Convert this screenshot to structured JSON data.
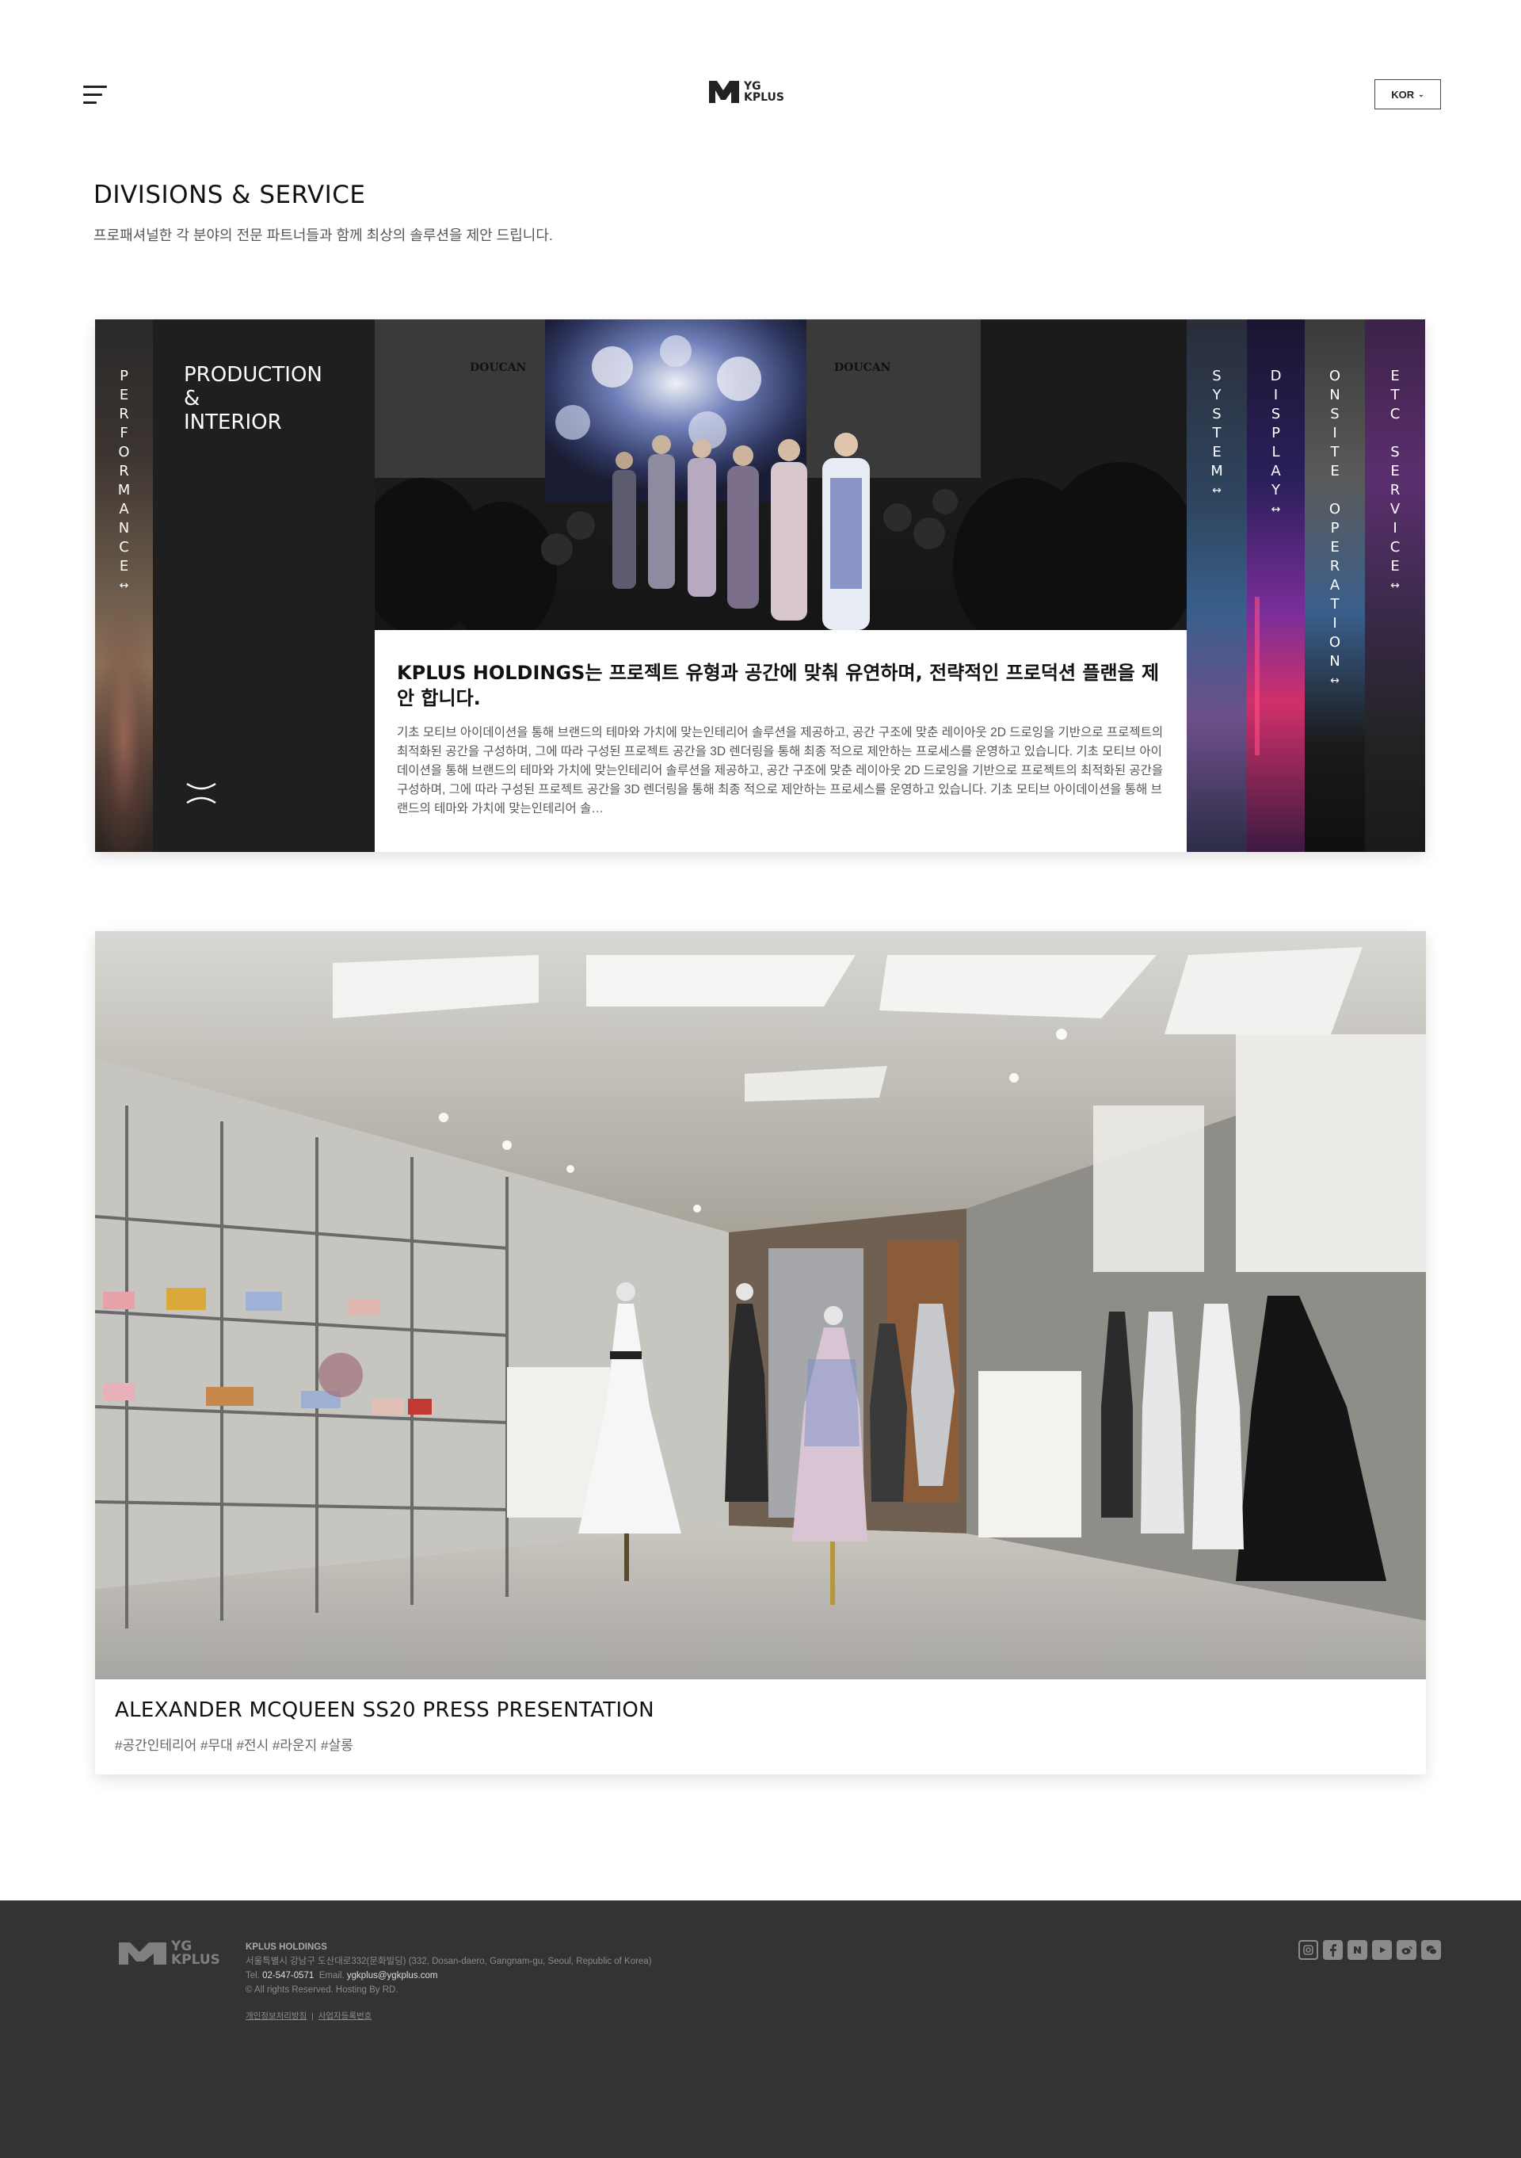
{
  "header": {
    "menu_icon": "hamburger-menu-icon",
    "logo_text": "YG\nKPLUS",
    "language": "KOR",
    "language_chevron": "⌄"
  },
  "section": {
    "title": "DIVISIONS & SERVICE",
    "subtitle": "프로패셔널한 각 분야의 전문 파트너들과 함께 최상의 솔루션을 제안 드립니다."
  },
  "divisions": {
    "arrow": "↔",
    "left_tabs": [
      {
        "label": [
          "P",
          "E",
          "R",
          "F",
          "O",
          "R",
          "M",
          "A",
          "N",
          "C",
          "E"
        ]
      }
    ],
    "active": {
      "title": "PRODUCTION\n&\nINTERIOR",
      "heading": "KPLUS HOLDINGS는 프로젝트 유형과 공간에 맞춰 유연하며, 전략적인 프로덕션 플랜을 제안 합니다.",
      "body": "기초 모티브 아이데이션을 통해 브랜드의 테마와 가치에 맞는인테리어 솔루션을 제공하고, 공간 구조에 맞춘 레이아웃 2D 드로잉을 기반으로 프로젝트의 최적화된 공간을 구성하며, 그에 따라 구성된 프로젝트 공간을 3D 렌더링을 통해 최종 적으로 제안하는 프로세스를 운영하고 있습니다. 기초 모티브 아이데이션을 통해 브랜드의 테마와 가치에 맞는인테리어 솔루션을 제공하고, 공간 구조에 맞춘 레이아웃 2D 드로잉을 기반으로 프로젝트의 최적화된 공간을 구성하며, 그에 따라 구성된 프로젝트 공간을 3D 렌더링을 통해 최종 적으로 제안하는 프로세스를 운영하고 있습니다. 기초 모티브 아이데이션을 통해 브랜드의 테마와 가치에 맞는인테리어 솔…",
      "brand_signage": "DOUCAN"
    },
    "right_tabs": [
      {
        "label": [
          "S",
          "Y",
          "S",
          "T",
          "E",
          "M"
        ]
      },
      {
        "label": [
          "D",
          "I",
          "S",
          "P",
          "L",
          "A",
          "Y"
        ]
      },
      {
        "label": [
          "O",
          "N",
          "S",
          "I",
          "T",
          "E",
          " ",
          "O",
          "P",
          "E",
          "R",
          "A",
          "T",
          "I",
          "O",
          "N"
        ]
      },
      {
        "label": [
          "E",
          "T",
          "C",
          " ",
          "S",
          "E",
          "R",
          "V",
          "I",
          "C",
          "E"
        ]
      }
    ]
  },
  "card": {
    "title": "ALEXANDER MCQUEEN SS20 PRESS PRESENTATION",
    "tags": "#공간인테리어 #무대 #전시 #라운지 #살롱"
  },
  "footer": {
    "logo_text": "YG\nKPLUS",
    "company": "KPLUS HOLDINGS",
    "address": "서울특별시 강남구 도산대로332(문화빌딩) (332, Dosan-daero, Gangnam-gu, Seoul, Republic of Korea)",
    "tel_label": "Tel.",
    "tel": "02-547-0571",
    "email_label": "Email.",
    "email": "ygkplus@ygkplus.com",
    "copyright": "© All rights Reserved. Hosting By RD.",
    "link_privacy": "개인정보처리방침",
    "link_sep": "|",
    "link_business": "사업자등록번호",
    "social_icons": [
      "instagram-icon",
      "facebook-icon",
      "naver-blog-icon",
      "youtube-icon",
      "weibo-icon",
      "wechat-icon"
    ]
  },
  "colors": {
    "footer_bg": "#333333",
    "panel_dark": "#1f1f1f",
    "text_dark": "#111111"
  }
}
